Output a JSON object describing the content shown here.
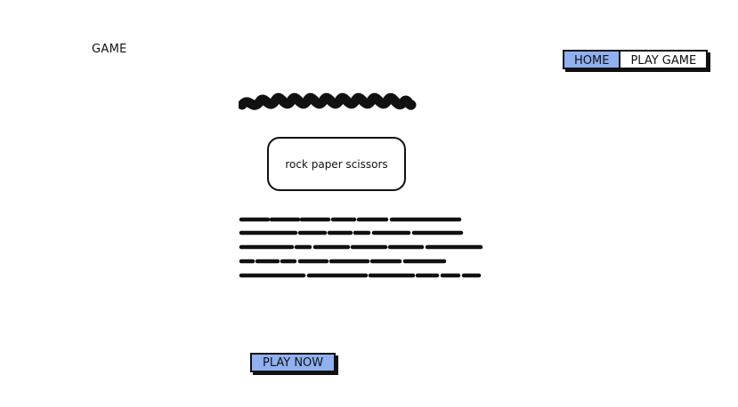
{
  "header": {
    "logo_text": "GAME",
    "nav": [
      {
        "label": "HOME",
        "active": true
      },
      {
        "label": "PLAY GAME",
        "active": false
      }
    ]
  },
  "main": {
    "title_box_text": "rock paper scissors",
    "cta_label": "PLAY NOW"
  },
  "colors": {
    "accent": "#8fb1f0",
    "ink": "#111111",
    "background": "#ffffff"
  }
}
